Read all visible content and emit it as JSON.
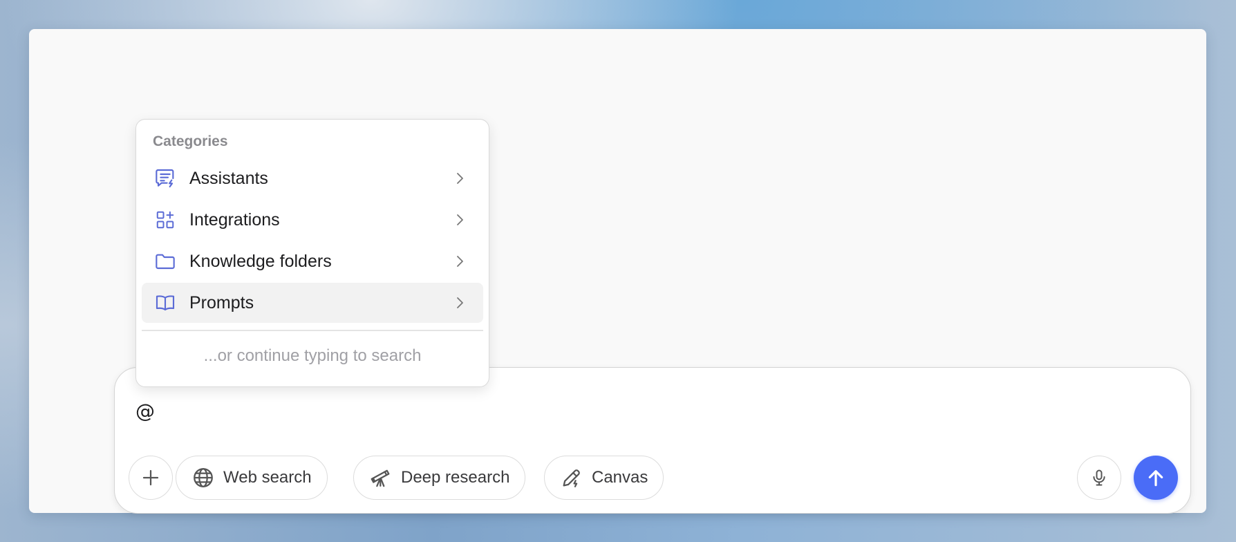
{
  "menu": {
    "heading": "Categories",
    "items": [
      {
        "label": "Assistants",
        "icon": "assistant-chat-icon"
      },
      {
        "label": "Integrations",
        "icon": "integrations-grid-icon"
      },
      {
        "label": "Knowledge folders",
        "icon": "folder-icon"
      },
      {
        "label": "Prompts",
        "icon": "book-icon"
      }
    ],
    "hint": "...or continue typing to search"
  },
  "composer": {
    "text": "@",
    "tools": [
      {
        "label": "Web search",
        "icon": "globe-icon"
      },
      {
        "label": "Deep research",
        "icon": "telescope-icon"
      },
      {
        "label": "Canvas",
        "icon": "pencil-icon"
      }
    ]
  },
  "colors": {
    "accent": "#4a6cf7",
    "menu_icon": "#5b6bd6",
    "active_row": "#f2f2f2"
  }
}
